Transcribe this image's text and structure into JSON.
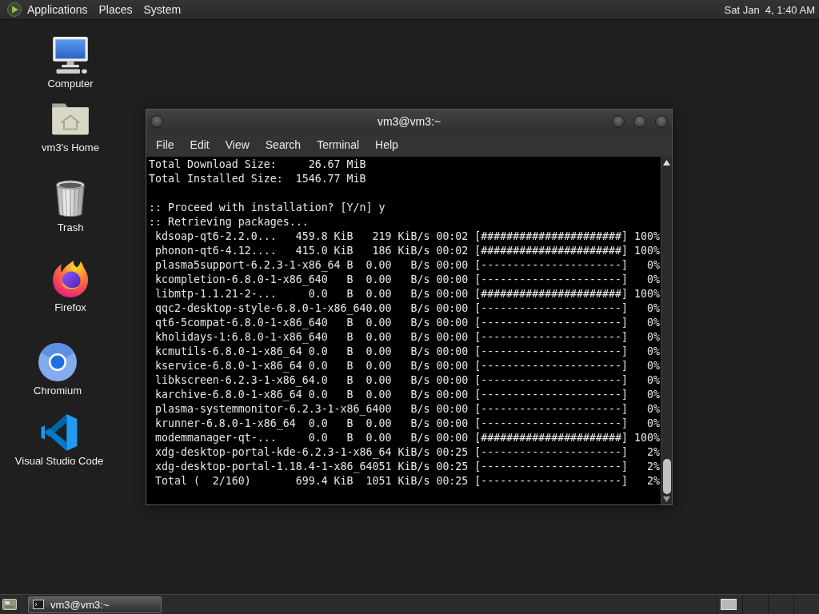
{
  "top_panel": {
    "menus": [
      "Applications",
      "Places",
      "System"
    ],
    "clock": "Sat Jan  4, 1:40 AM"
  },
  "desktop_icons": [
    {
      "kind": "computer",
      "label": "Computer"
    },
    {
      "kind": "home",
      "label": "vm3's Home"
    },
    {
      "kind": "trash",
      "label": "Trash"
    },
    {
      "kind": "firefox",
      "label": "Firefox"
    },
    {
      "kind": "chromium",
      "label": "Chromium"
    },
    {
      "kind": "vscode",
      "label": "Visual Studio Code"
    }
  ],
  "terminal_window": {
    "title": "vm3@vm3:~",
    "menu": [
      "File",
      "Edit",
      "View",
      "Search",
      "Terminal",
      "Help"
    ],
    "output": [
      [
        "Total Download Size:     26.67 MiB",
        "Total Installed Size:  1546.77 MiB"
      ],
      [
        ":: Proceed with installation? [Y/n] y",
        ":: Retrieving packages...",
        " kdsoap-qt6-2.2.0...   459.8 KiB   219 KiB/s 00:02 [######################] 100%",
        " phonon-qt6-4.12....   415.0 KiB   186 KiB/s 00:02 [######################] 100%",
        " plasma5support-6.2.3-1-x86_64 B  0.00   B/s 00:00 [----------------------]   0%",
        " kcompletion-6.8.0-1-x86_640   B  0.00   B/s 00:00 [----------------------]   0%",
        " libmtp-1.1.21-2-...     0.0   B  0.00   B/s 00:00 [######################] 100%",
        " qqc2-desktop-style-6.8.0-1-x86_640.00   B/s 00:00 [----------------------]   0%",
        " qt6-5compat-6.8.0-1-x86_640   B  0.00   B/s 00:00 [----------------------]   0%",
        " kholidays-1:6.8.0-1-x86_640   B  0.00   B/s 00:00 [----------------------]   0%",
        " kcmutils-6.8.0-1-x86_64 0.0   B  0.00   B/s 00:00 [----------------------]   0%",
        " kservice-6.8.0-1-x86_64 0.0   B  0.00   B/s 00:00 [----------------------]   0%",
        " libkscreen-6.2.3-1-x86_64.0   B  0.00   B/s 00:00 [----------------------]   0%",
        " karchive-6.8.0-1-x86_64 0.0   B  0.00   B/s 00:00 [----------------------]   0%",
        " plasma-systemmonitor-6.2.3-1-x86_6400   B/s 00:00 [----------------------]   0%",
        " krunner-6.8.0-1-x86_64  0.0   B  0.00   B/s 00:00 [----------------------]   0%",
        " modemmanager-qt-...     0.0   B  0.00   B/s 00:00 [######################] 100%",
        " xdg-desktop-portal-kde-6.2.3-1-x86_64 KiB/s 00:25 [----------------------]   2%",
        " xdg-desktop-portal-1.18.4-1-x86_64051 KiB/s 00:25 [----------------------]   2%",
        " Total (  2/160)       699.4 KiB  1051 KiB/s 00:25 [----------------------]   2%"
      ]
    ]
  },
  "taskbar": {
    "tasks": [
      {
        "label": "vm3@vm3:~",
        "active": true
      }
    ],
    "workspaces": [
      {
        "has_window": true
      },
      {
        "has_window": false
      },
      {
        "has_window": false
      },
      {
        "has_window": false
      }
    ]
  }
}
